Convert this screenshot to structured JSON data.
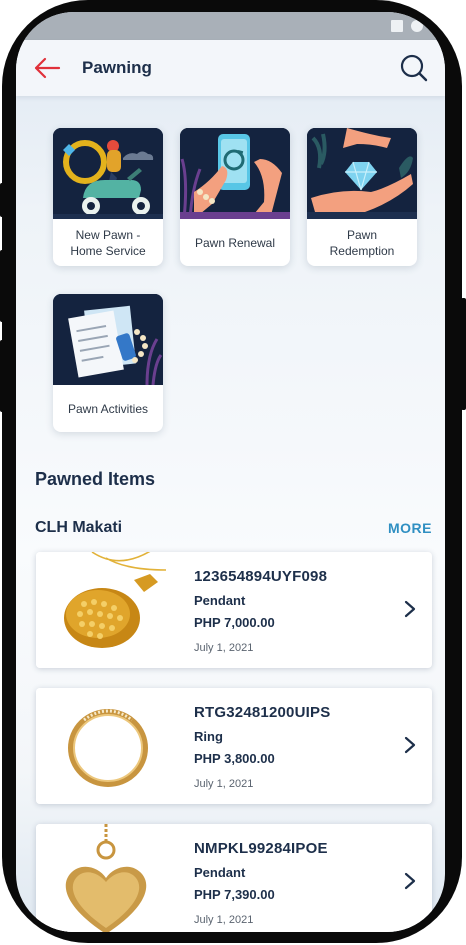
{
  "header": {
    "title": "Pawning",
    "back_icon": "arrow-left-icon",
    "search_icon": "search-icon"
  },
  "services": [
    {
      "label": "New Pawn -\nHome Service",
      "illustration": "scooter-courier-ring"
    },
    {
      "label": "Pawn Renewal",
      "illustration": "phone-refresh-hand"
    },
    {
      "label": "Pawn\nRedemption",
      "illustration": "diamond-hands"
    },
    {
      "label": "Pawn Activities",
      "illustration": "documents-pearls"
    }
  ],
  "pawned_items": {
    "title": "Pawned Items",
    "branch": "CLH Makati",
    "more_label": "MORE",
    "items": [
      {
        "code": "123654894UYF098",
        "type": "Pendant",
        "price": "PHP 7,000.00",
        "date": "July 1, 2021",
        "image": "gold-textured-pendant"
      },
      {
        "code": "RTG32481200UIPS",
        "type": "Ring",
        "price": "PHP 3,800.00",
        "date": "July 1, 2021",
        "image": "gold-ring"
      },
      {
        "code": "NMPKL99284IPOE",
        "type": "Pendant",
        "price": "PHP 7,390.00",
        "date": "July 1, 2021",
        "image": "gold-heart-pendant"
      }
    ]
  },
  "colors": {
    "primary_text": "#1d2f4a",
    "accent": "#2f8fc2",
    "back_arrow": "#e0313a",
    "illustration_bg": "#14233f"
  }
}
